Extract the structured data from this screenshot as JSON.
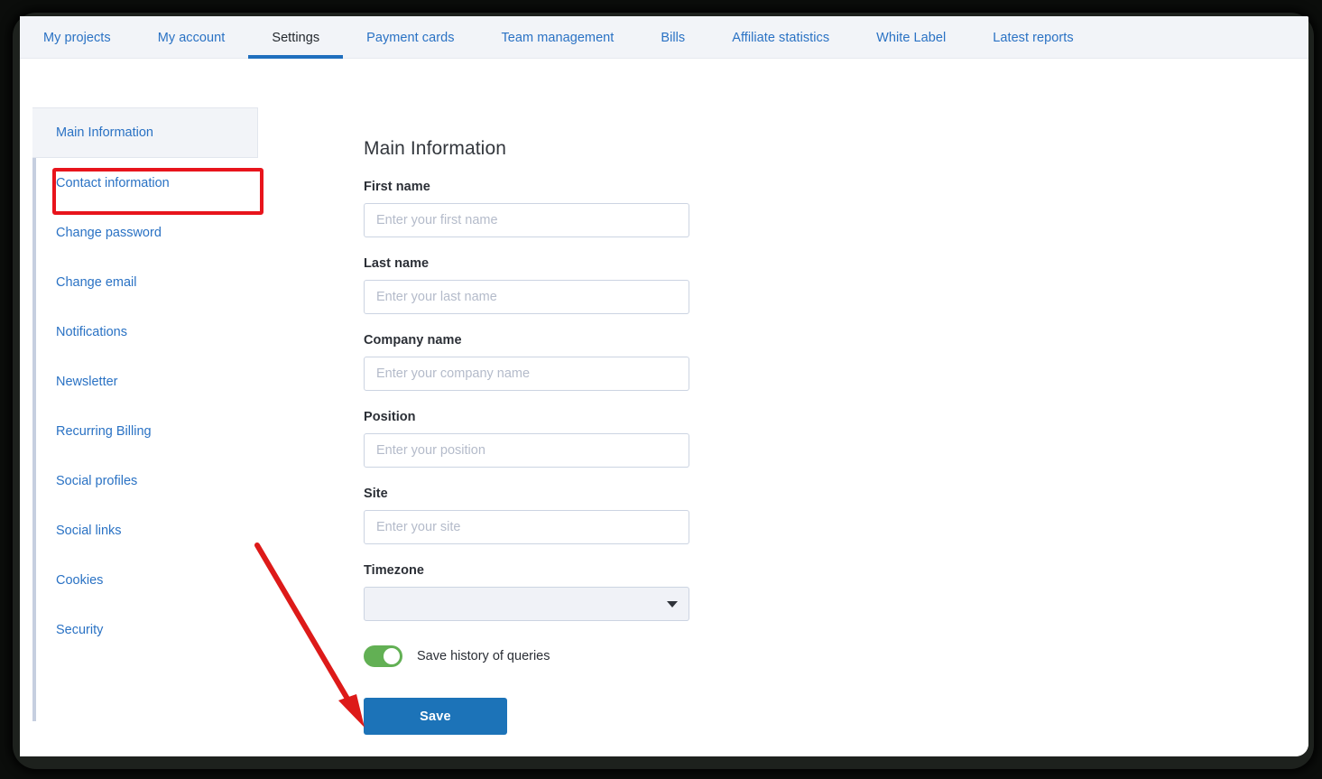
{
  "topnav": {
    "items": [
      {
        "label": "My projects",
        "active": false
      },
      {
        "label": "My account",
        "active": false
      },
      {
        "label": "Settings",
        "active": true
      },
      {
        "label": "Payment cards",
        "active": false
      },
      {
        "label": "Team management",
        "active": false
      },
      {
        "label": "Bills",
        "active": false
      },
      {
        "label": "Affiliate statistics",
        "active": false
      },
      {
        "label": "White Label",
        "active": false
      },
      {
        "label": "Latest reports",
        "active": false
      }
    ],
    "active_underline_color": "#1f6fbe",
    "link_color": "#2a72c4",
    "background_color": "#f2f4f8"
  },
  "sidebar": {
    "items": [
      {
        "label": "Main Information",
        "active": true
      },
      {
        "label": "Contact information",
        "active": false
      },
      {
        "label": "Change password",
        "active": false
      },
      {
        "label": "Change email",
        "active": false
      },
      {
        "label": "Notifications",
        "active": false
      },
      {
        "label": "Newsletter",
        "active": false
      },
      {
        "label": "Recurring Billing",
        "active": false
      },
      {
        "label": "Social profiles",
        "active": false
      },
      {
        "label": "Social links",
        "active": false
      },
      {
        "label": "Cookies",
        "active": false
      },
      {
        "label": "Security",
        "active": false
      }
    ]
  },
  "main": {
    "title": "Main Information",
    "fields": [
      {
        "label": "First name",
        "placeholder": "Enter your first name",
        "value": "",
        "type": "text"
      },
      {
        "label": "Last name",
        "placeholder": "Enter your last name",
        "value": "",
        "type": "text"
      },
      {
        "label": "Company name",
        "placeholder": "Enter your company name",
        "value": "",
        "type": "text"
      },
      {
        "label": "Position",
        "placeholder": "Enter your position",
        "value": "",
        "type": "text"
      },
      {
        "label": "Site",
        "placeholder": "Enter your site",
        "value": "",
        "type": "text"
      }
    ],
    "timezone": {
      "label": "Timezone",
      "selected": "",
      "options": [
        ""
      ],
      "chevron_icon": "chevron-down-icon"
    },
    "toggle": {
      "label": "Save history of queries",
      "checked": true,
      "on_color": "#62b054"
    },
    "save_button": {
      "label": "Save",
      "color": "#1c73b8"
    }
  },
  "annotations": {
    "highlight_color": "#e8141c",
    "rect_target": "sidebar-item-main-information",
    "arrow_target": "save-history-toggle"
  }
}
